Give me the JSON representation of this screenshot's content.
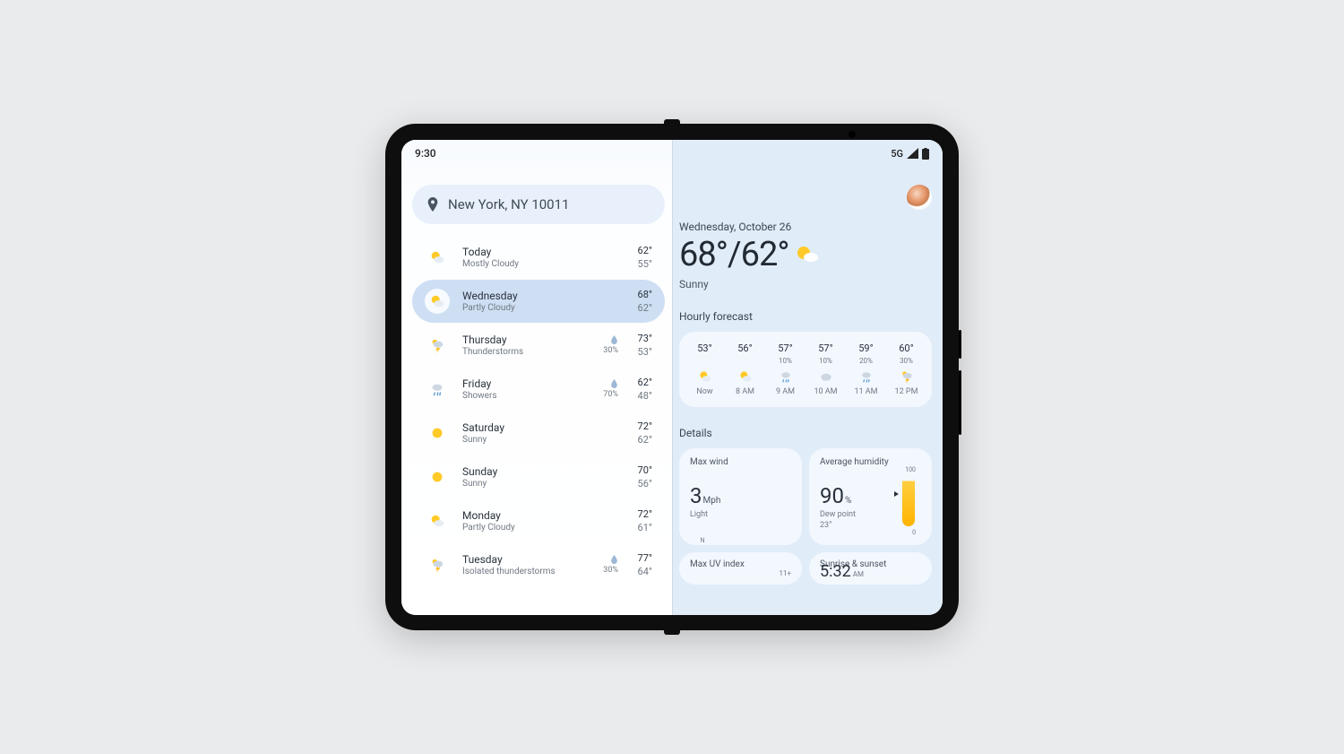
{
  "status": {
    "time": "9:30",
    "network": "5G"
  },
  "search": {
    "location": "New York, NY 10011"
  },
  "days": [
    {
      "name": "Today",
      "cond": "Mostly Cloudy",
      "hi": "62°",
      "lo": "55°",
      "precip": "",
      "icon": "partly"
    },
    {
      "name": "Wednesday",
      "cond": "Partly Cloudy",
      "hi": "68°",
      "lo": "62°",
      "precip": "",
      "icon": "partly",
      "selected": true
    },
    {
      "name": "Thursday",
      "cond": "Thunderstorms",
      "hi": "73°",
      "lo": "53°",
      "precip": "30%",
      "icon": "storm"
    },
    {
      "name": "Friday",
      "cond": "Showers",
      "hi": "62°",
      "lo": "48°",
      "precip": "70%",
      "icon": "rain"
    },
    {
      "name": "Saturday",
      "cond": "Sunny",
      "hi": "72°",
      "lo": "62°",
      "precip": "",
      "icon": "sun"
    },
    {
      "name": "Sunday",
      "cond": "Sunny",
      "hi": "70°",
      "lo": "56°",
      "precip": "",
      "icon": "sun"
    },
    {
      "name": "Monday",
      "cond": "Partly Cloudy",
      "hi": "72°",
      "lo": "61°",
      "precip": "",
      "icon": "partly"
    },
    {
      "name": "Tuesday",
      "cond": "Isolated thunderstorms",
      "hi": "77°",
      "lo": "64°",
      "precip": "30%",
      "icon": "storm"
    }
  ],
  "hero": {
    "date": "Wednesday, October 26",
    "hi": "68°",
    "lo": "/62°",
    "cond": "Sunny"
  },
  "hourly": {
    "title": "Hourly forecast",
    "items": [
      {
        "temp": "53°",
        "precip": "",
        "icon": "partly",
        "label": "Now"
      },
      {
        "temp": "56°",
        "precip": "",
        "icon": "partly",
        "label": "8 AM"
      },
      {
        "temp": "57°",
        "precip": "10%",
        "icon": "rain",
        "label": "9 AM"
      },
      {
        "temp": "57°",
        "precip": "10%",
        "icon": "cloud",
        "label": "10 AM"
      },
      {
        "temp": "59°",
        "precip": "20%",
        "icon": "rain",
        "label": "11 AM"
      },
      {
        "temp": "60°",
        "precip": "30%",
        "icon": "storm",
        "label": "12 PM"
      }
    ]
  },
  "details": {
    "title": "Details",
    "wind": {
      "title": "Max wind",
      "value": "3",
      "unit": "Mph",
      "sub": "Light",
      "n": "N"
    },
    "humidity": {
      "title": "Average humidity",
      "value": "90",
      "unit": "%",
      "sub1": "Dew point",
      "sub2": "23°",
      "scaleTop": "100",
      "scaleBot": "0"
    },
    "uv": {
      "title": "Max UV index",
      "note": "11+"
    },
    "sun": {
      "title": "Sunrise & sunset",
      "value": "5:32",
      "unit": "AM"
    }
  }
}
